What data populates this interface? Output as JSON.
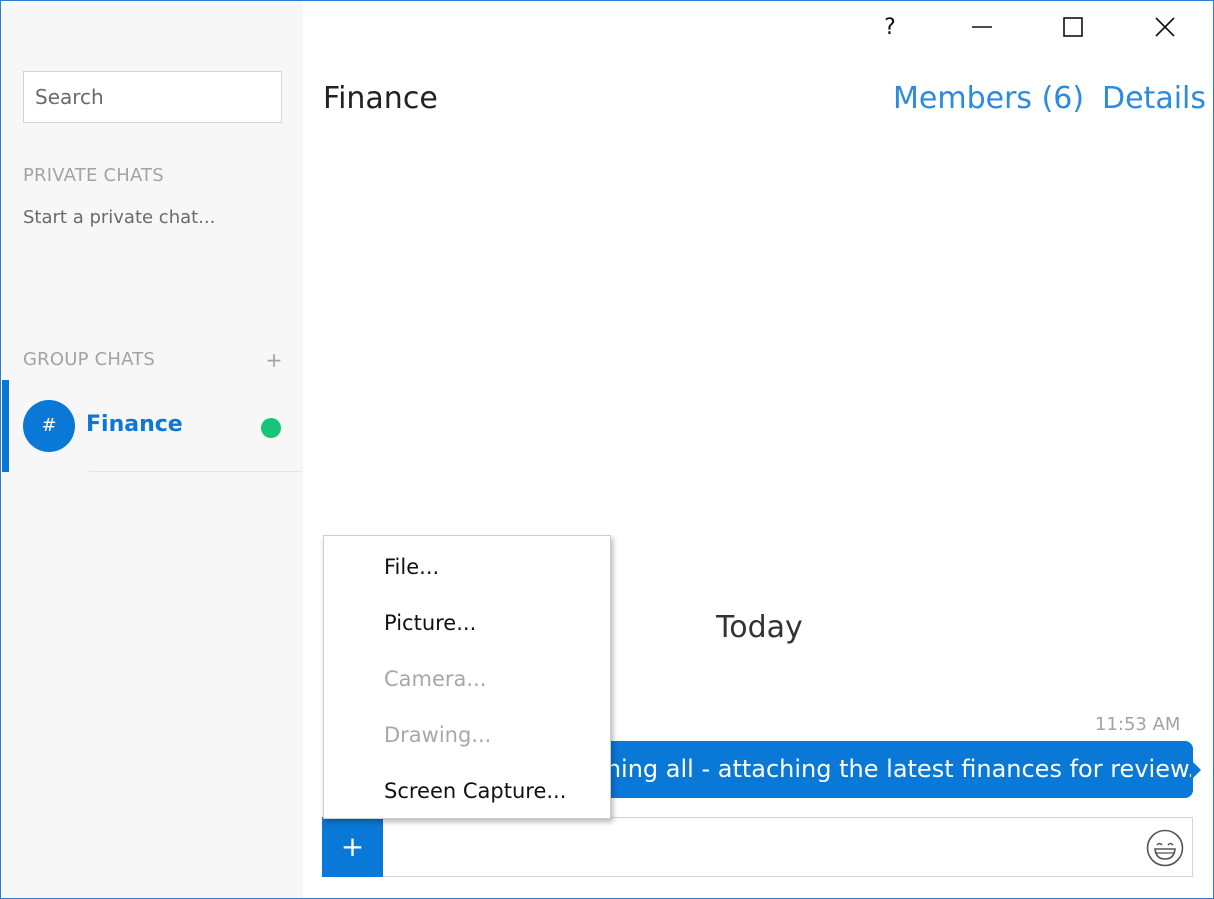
{
  "window": {
    "controls": {
      "help": "?"
    }
  },
  "sidebar": {
    "search": {
      "placeholder": "Search",
      "value": ""
    },
    "private_chats": {
      "header": "PRIVATE CHATS",
      "start_link": "Start a private chat..."
    },
    "group_chats": {
      "header": "GROUP CHATS",
      "add_glyph": "+",
      "items": [
        {
          "avatar": "#",
          "name": "Finance",
          "selected": true,
          "status": "online",
          "status_color": "#16c47a"
        }
      ]
    }
  },
  "header": {
    "title": "Finance",
    "members_link": "Members (6)",
    "details_link": "Details"
  },
  "conversation": {
    "day_separator": "Today",
    "messages": [
      {
        "time": "11:53 AM",
        "text": "Morning all - attaching the latest finances for review."
      }
    ]
  },
  "composer": {
    "attach_glyph": "+",
    "placeholder": "",
    "emoji_icon": "smiley-face-icon"
  },
  "attach_menu": {
    "items": [
      {
        "label": "File...",
        "enabled": true
      },
      {
        "label": "Picture...",
        "enabled": true
      },
      {
        "label": "Camera...",
        "enabled": false
      },
      {
        "label": "Drawing...",
        "enabled": false
      },
      {
        "label": "Screen Capture...",
        "enabled": true
      }
    ]
  },
  "colors": {
    "accent": "#0a78d7",
    "link": "#2b8be0",
    "sidebar_bg": "#f7f7f7",
    "online": "#16c47a",
    "disabled_text": "#a8a8a8"
  }
}
